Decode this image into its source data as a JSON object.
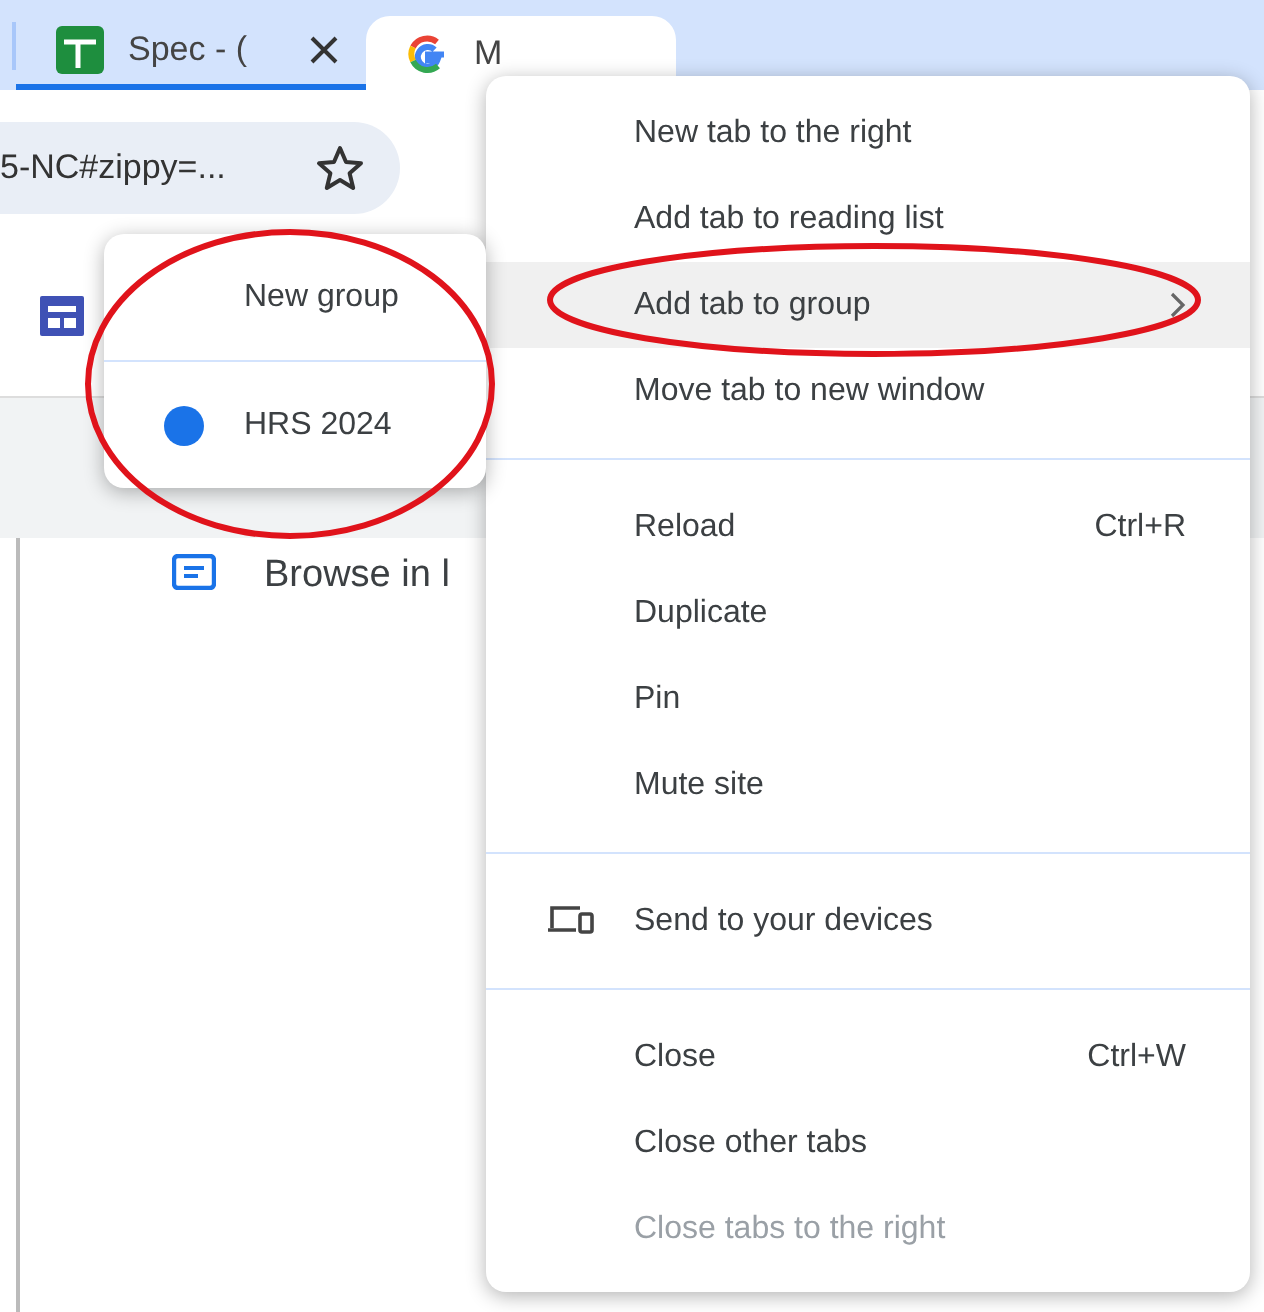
{
  "tabs": [
    {
      "title": "Spec - (",
      "kind": "sheets",
      "selected": false
    },
    {
      "title": "M",
      "kind": "google",
      "selected": true
    }
  ],
  "address_bar": {
    "value": "5-NC#zippy=..."
  },
  "page": {
    "link": "Browse in l"
  },
  "context_menu": {
    "items": [
      {
        "kind": "item",
        "label": "New tab to the right",
        "highlighted": false,
        "disabled": false
      },
      {
        "kind": "item",
        "label": "Add tab to reading list",
        "highlighted": false,
        "disabled": false
      },
      {
        "kind": "submenu",
        "label": "Add tab to group",
        "highlighted": true,
        "disabled": false
      },
      {
        "kind": "item",
        "label": "Move tab to new window",
        "highlighted": false,
        "disabled": false
      },
      {
        "kind": "separator"
      },
      {
        "kind": "item",
        "label": "Reload",
        "shortcut": "Ctrl+R",
        "highlighted": false,
        "disabled": false
      },
      {
        "kind": "item",
        "label": "Duplicate",
        "highlighted": false,
        "disabled": false
      },
      {
        "kind": "item",
        "label": "Pin",
        "highlighted": false,
        "disabled": false
      },
      {
        "kind": "item",
        "label": "Mute site",
        "highlighted": false,
        "disabled": false
      },
      {
        "kind": "separator"
      },
      {
        "kind": "icon_item",
        "label": "Send to your devices",
        "highlighted": false,
        "disabled": false
      },
      {
        "kind": "separator"
      },
      {
        "kind": "item",
        "label": "Close",
        "shortcut": "Ctrl+W",
        "highlighted": false,
        "disabled": false
      },
      {
        "kind": "item",
        "label": "Close other tabs",
        "highlighted": false,
        "disabled": false
      },
      {
        "kind": "item",
        "label": "Close tabs to the right",
        "highlighted": false,
        "disabled": true
      }
    ]
  },
  "group_submenu": {
    "items": [
      {
        "kind": "new",
        "label": "New group"
      },
      {
        "kind": "separator"
      },
      {
        "kind": "group",
        "label": "HRS 2024",
        "color": "#1a73e8"
      }
    ]
  }
}
